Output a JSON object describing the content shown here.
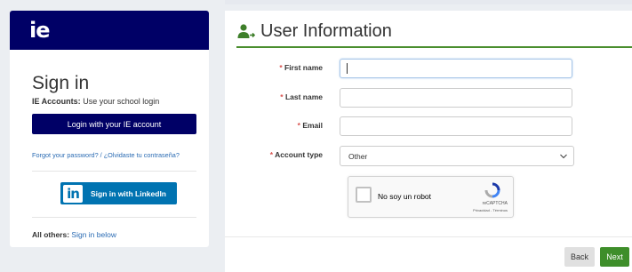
{
  "sidebar": {
    "logo": "ie",
    "title": "Sign in",
    "accounts_bold": "IE Accounts:",
    "accounts_text": " Use your school login",
    "ie_login_button": "Login with your IE account",
    "forgot_link": "Forgot your password? / ¿Olvidaste tu contraseña?",
    "linkedin_logo": "in",
    "linkedin_button": "Sign in with LinkedIn",
    "others_bold": "All others:",
    "others_link": "Sign in below",
    "colors": {
      "brand": "#000066",
      "linkedin": "#0073b1",
      "link": "#2a6bb3"
    }
  },
  "form": {
    "title": "User Information",
    "accent_color": "#4a8e2e",
    "fields": [
      {
        "required_mark": "*",
        "label": "First name",
        "value": ""
      },
      {
        "required_mark": "*",
        "label": "Last name",
        "value": ""
      },
      {
        "required_mark": "*",
        "label": "Email",
        "value": ""
      },
      {
        "required_mark": "*",
        "label": "Account type",
        "value": "Other"
      }
    ],
    "captcha": {
      "label": "No soy un robot",
      "brand": "reCAPTCHA",
      "privacy": "Privacidad - Términos"
    },
    "back_button": "Back",
    "next_button": "Next"
  }
}
